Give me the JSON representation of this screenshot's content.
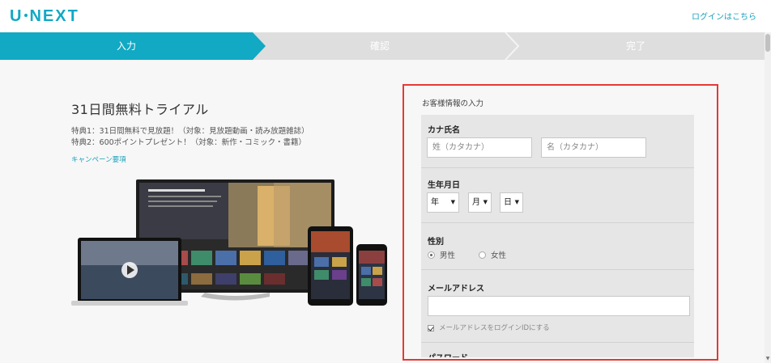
{
  "header": {
    "logo_text": "U-NEXT",
    "login_link": "ログインはこちら"
  },
  "steps": [
    {
      "label": "入力",
      "active": true
    },
    {
      "label": "確認",
      "active": false
    },
    {
      "label": "完了",
      "active": false
    }
  ],
  "promo": {
    "title": "31日間無料トライアル",
    "benefit_1": "特典1：31日間無料で見放題！（対象：見放題動画・読み放題雑誌）",
    "benefit_2": "特典2：600ポイントプレゼント！（対象：新作・コミック・書籍）",
    "campaign_link": "キャンペーン要項"
  },
  "form": {
    "title": "お客様情報の入力",
    "kana_name": {
      "label": "カナ氏名",
      "last_placeholder": "姓（カタカナ）",
      "first_placeholder": "名（カタカナ）"
    },
    "birthdate": {
      "label": "生年月日",
      "year": "年",
      "month": "月",
      "day": "日"
    },
    "gender": {
      "label": "性別",
      "options": [
        {
          "label": "男性",
          "selected": true
        },
        {
          "label": "女性",
          "selected": false
        }
      ]
    },
    "email": {
      "label": "メールアドレス",
      "value": "",
      "use_as_login_label": "メールアドレスをログインIDにする",
      "use_as_login_checked": true
    },
    "password": {
      "label": "パスワード"
    }
  },
  "colors": {
    "brand": "#11a9c3",
    "highlight_border": "#e53935",
    "step_inactive": "#dedede"
  }
}
